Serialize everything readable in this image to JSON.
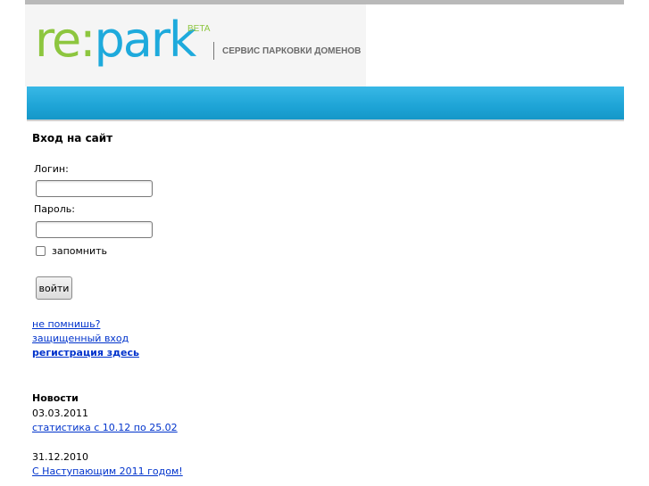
{
  "header": {
    "logo": {
      "re": "re",
      "colon": ":",
      "park": "park",
      "beta": "BETA",
      "tagline": "СЕРВИС ПАРКОВКИ ДОМЕНОВ"
    }
  },
  "login": {
    "title": "Вход на сайт",
    "login_label": "Логин:",
    "login_value": "",
    "password_label": "Пароль:",
    "password_value": "",
    "remember_label": "запомнить",
    "remember_checked": false,
    "submit_label": "войти"
  },
  "links": {
    "forgot": "не помнишь?",
    "secure_login": "защищенный вход",
    "register": "регистрация здесь"
  },
  "news": {
    "title": "Новости",
    "items": [
      {
        "date": "03.03.2011",
        "link": "статистика с 10.12 по 25.02"
      },
      {
        "date": "31.12.2010",
        "link": "С Наступающим 2011 годом!"
      }
    ]
  },
  "colors": {
    "brand_green": "#8dc63f",
    "brand_blue": "#1eaadc",
    "link": "#0033cc"
  }
}
